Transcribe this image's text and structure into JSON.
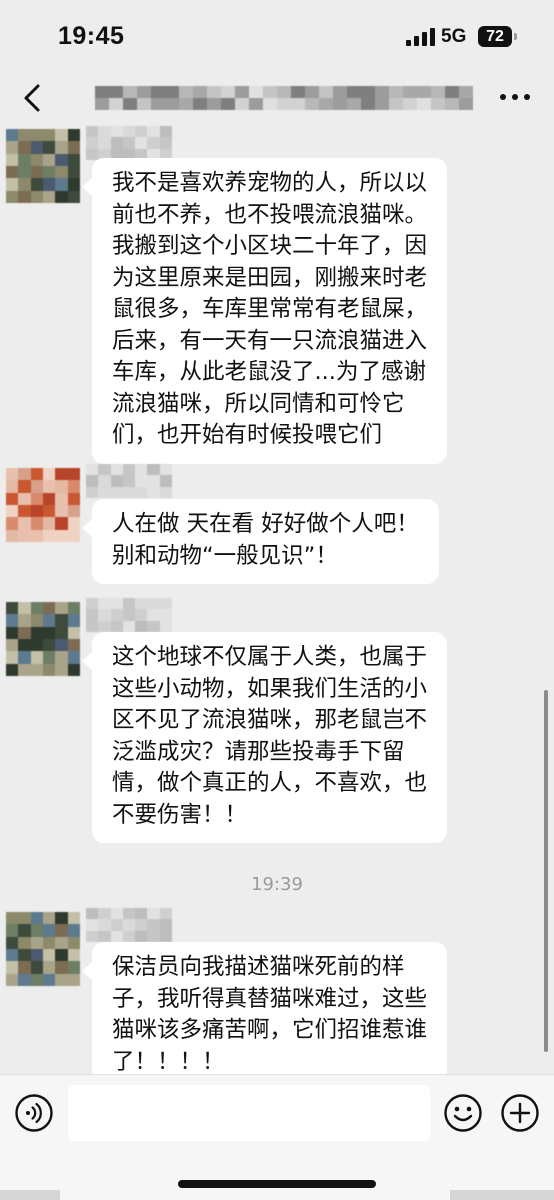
{
  "status_bar": {
    "time": "19:45",
    "network": "5G",
    "battery": "72",
    "icons": [
      "signal-icon",
      "battery-icon"
    ]
  },
  "nav": {
    "icons": [
      "back-icon",
      "more-icon"
    ]
  },
  "messages": [
    {
      "lines": [
        "我不是喜欢养宠物的人，所以以",
        "前也不养，也不投喂流浪猫咪。",
        "我搬到这个小区块二十年了，因",
        "为这里原来是田园，刚搬来时老",
        "鼠很多，车库里常常有老鼠屎，",
        "后来，有一天有一只流浪猫进入",
        "车库，从此老鼠没了...为了感谢",
        "流浪猫咪，所以同情和可怜它",
        "们，也开始有时候投喂它们"
      ]
    },
    {
      "lines": [
        "人在做 天在看 好好做个人吧！",
        "别和动物“一般见识”！"
      ]
    },
    {
      "lines": [
        "这个地球不仅属于人类，也属于",
        "这些小动物，如果我们生活的小",
        "区不见了流浪猫咪，那老鼠岂不",
        "泛滥成灾？请那些投毒手下留",
        "情，做个真正的人，不喜欢，也",
        "不要伤害！！"
      ]
    },
    {
      "lines": [
        "保洁员向我描述猫咪死前的样",
        "子，我听得真替猫咪难过，这些",
        "猫咪该多痛苦啊，它们招谁惹谁",
        "了！！！！"
      ]
    }
  ],
  "timestamp": "19:39",
  "input_bar": {
    "placeholder": "",
    "icons": [
      "voice-icon",
      "emoji-icon",
      "plus-icon"
    ]
  },
  "colors": {
    "background": "#ededed",
    "bubble": "#ffffff",
    "text": "#111111",
    "timestamp": "#9a9a9a",
    "input_bar": "#f6f6f6"
  }
}
